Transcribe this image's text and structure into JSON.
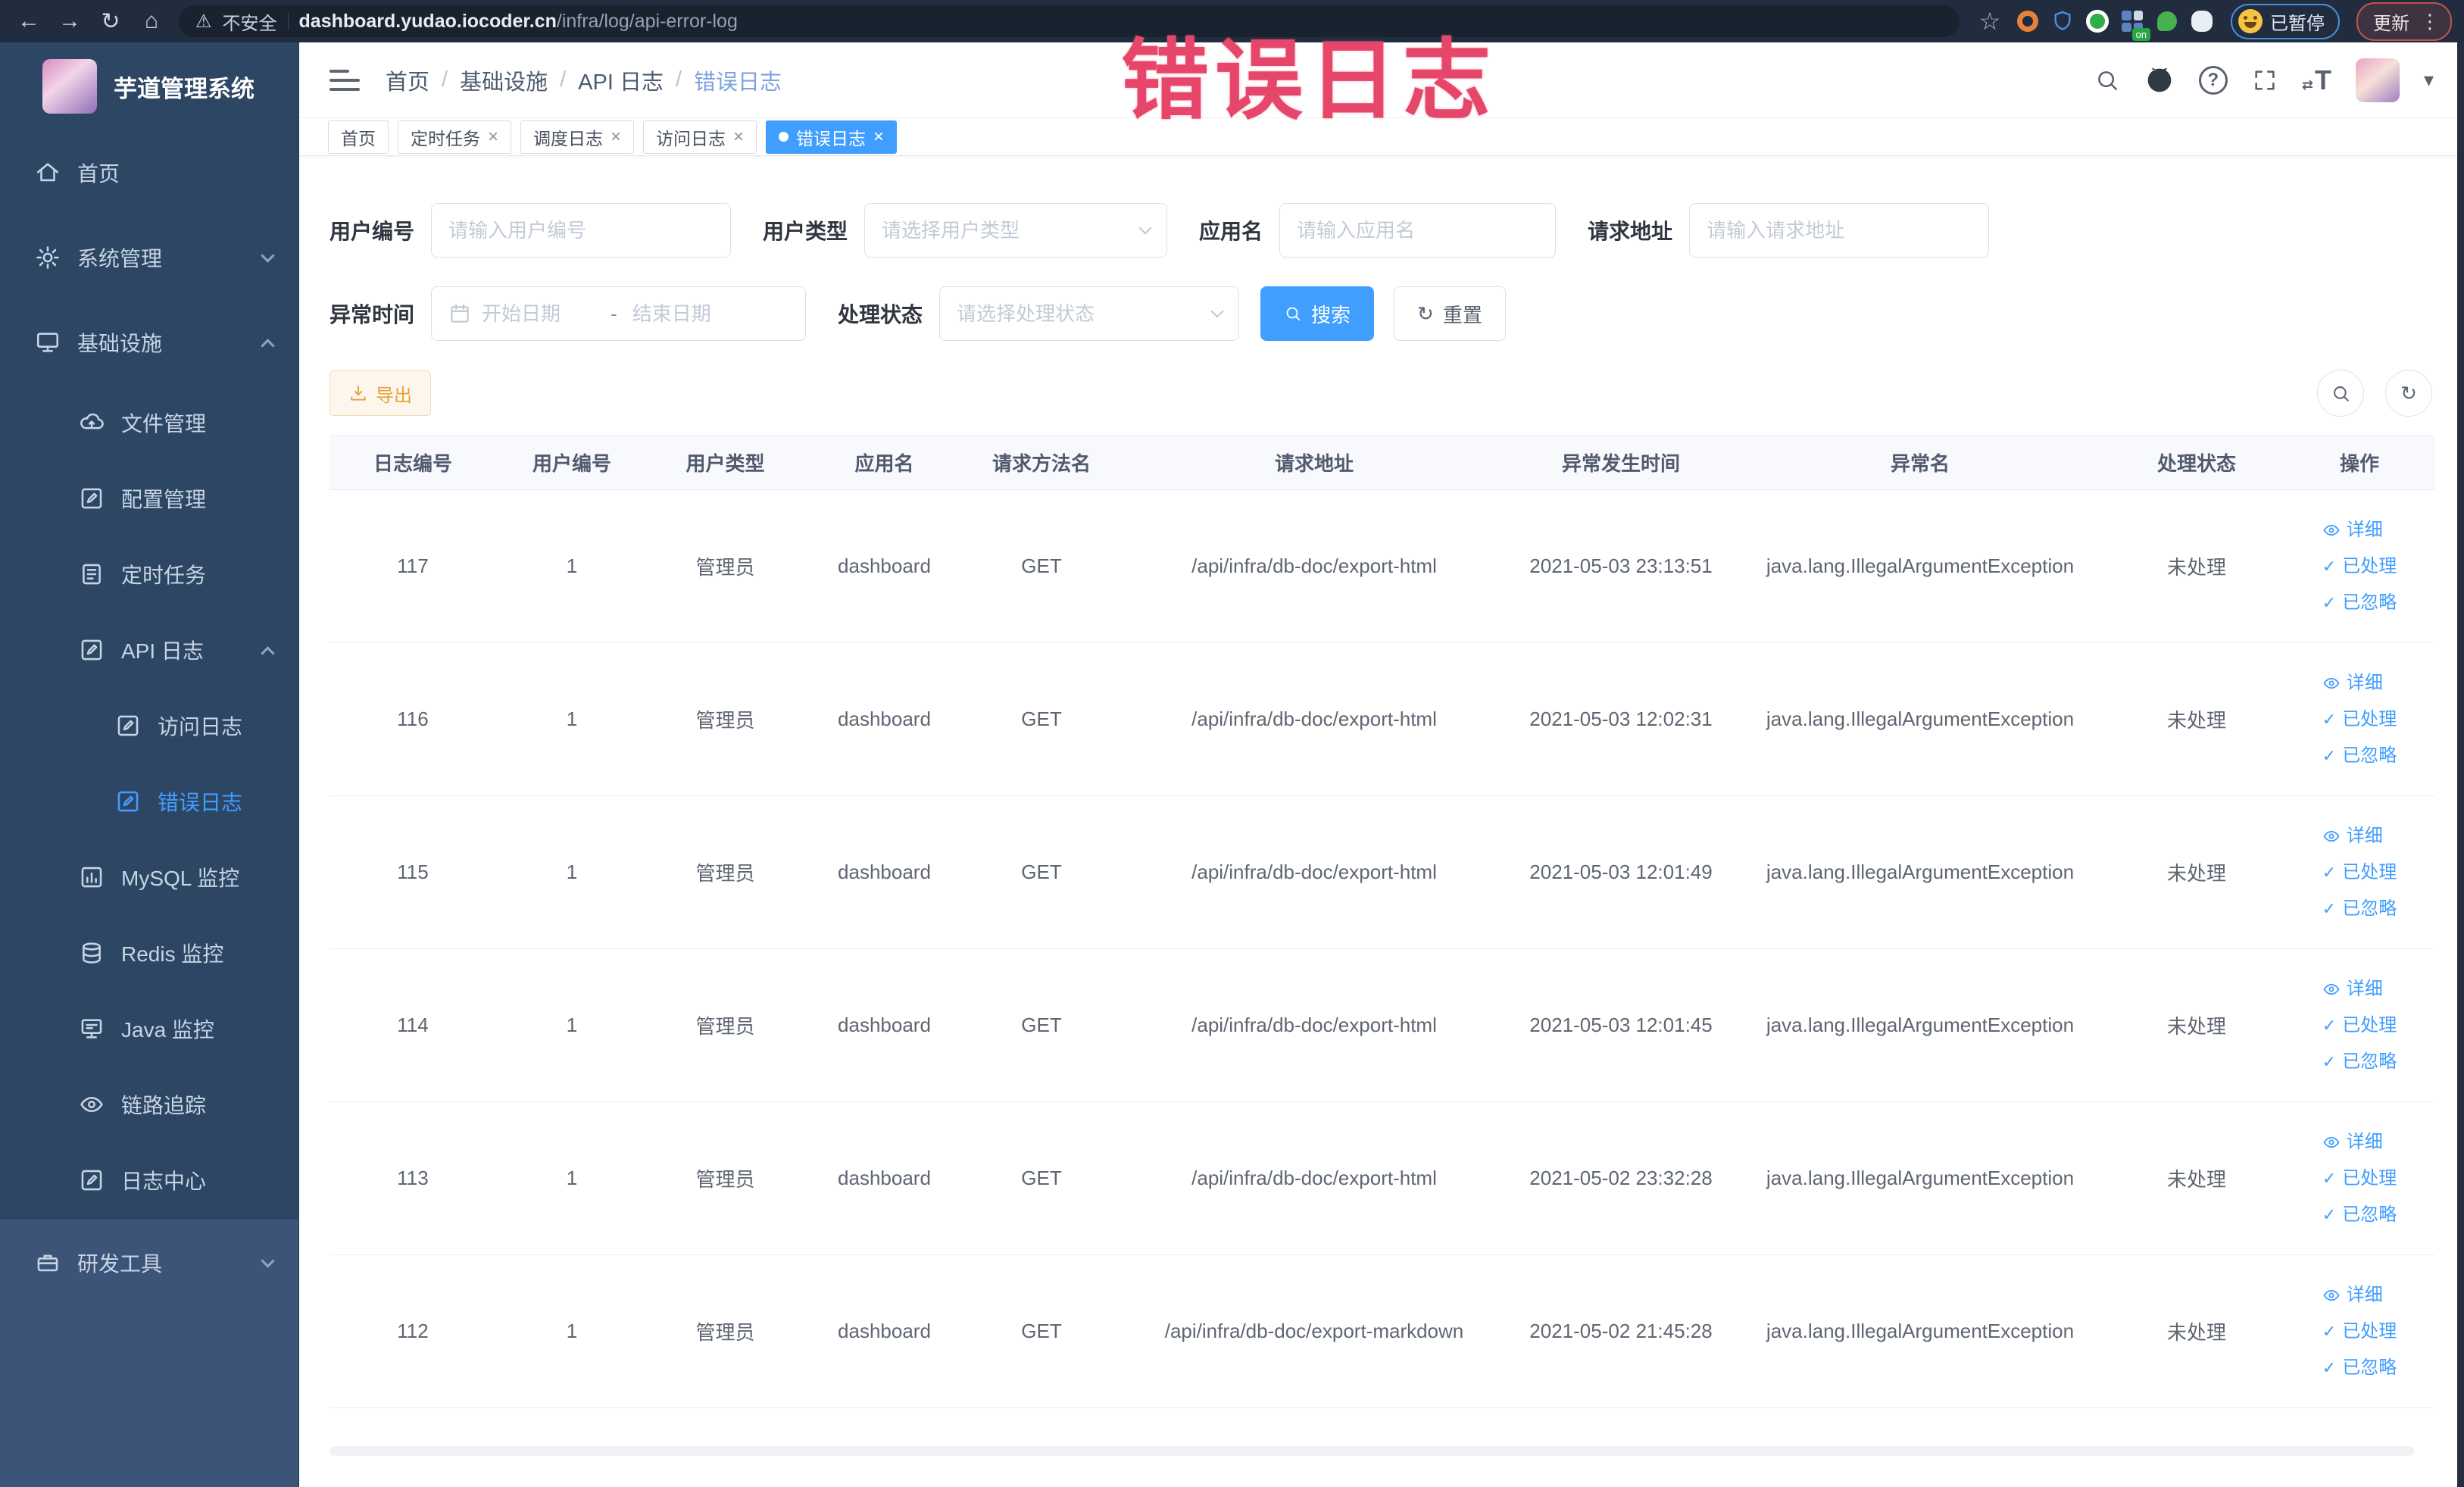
{
  "colors": {
    "primary": "#409eff",
    "warning": "#e6a23c",
    "overlay_red": "#e7466b",
    "sidebar_bg": "#2d4664",
    "chrome_bg": "#212d3f"
  },
  "overlay_text": "错误日志",
  "browser": {
    "security_label": "不安全",
    "url_host": "dashboard.yudao.iocoder.cn",
    "url_path": "/infra/log/api-error-log",
    "paused_label": "已暂停",
    "update_label": "更新"
  },
  "sidebar": {
    "title": "芋道管理系统",
    "items": [
      {
        "label": "首页"
      },
      {
        "label": "系统管理"
      },
      {
        "label": "基础设施"
      },
      {
        "label": "文件管理"
      },
      {
        "label": "配置管理"
      },
      {
        "label": "定时任务"
      },
      {
        "label": "API 日志"
      },
      {
        "label": "访问日志"
      },
      {
        "label": "错误日志"
      },
      {
        "label": "MySQL 监控"
      },
      {
        "label": "Redis 监控"
      },
      {
        "label": "Java 监控"
      },
      {
        "label": "链路追踪"
      },
      {
        "label": "日志中心"
      },
      {
        "label": "研发工具"
      }
    ]
  },
  "breadcrumb": [
    "首页",
    "基础设施",
    "API 日志",
    "错误日志"
  ],
  "tabs": [
    {
      "label": "首页"
    },
    {
      "label": "定时任务"
    },
    {
      "label": "调度日志"
    },
    {
      "label": "访问日志"
    },
    {
      "label": "错误日志"
    }
  ],
  "filters": {
    "user_id_label": "用户编号",
    "user_id_placeholder": "请输入用户编号",
    "user_type_label": "用户类型",
    "user_type_placeholder": "请选择用户类型",
    "app_name_label": "应用名",
    "app_name_placeholder": "请输入应用名",
    "request_url_label": "请求地址",
    "request_url_placeholder": "请输入请求地址",
    "exception_time_label": "异常时间",
    "start_date_placeholder": "开始日期",
    "range_separator": "-",
    "end_date_placeholder": "结束日期",
    "process_status_label": "处理状态",
    "process_status_placeholder": "请选择处理状态",
    "search_label": "搜索",
    "reset_label": "重置"
  },
  "toolbar": {
    "export_label": "导出"
  },
  "table": {
    "columns": [
      "日志编号",
      "用户编号",
      "用户类型",
      "应用名",
      "请求方法名",
      "请求地址",
      "异常发生时间",
      "异常名",
      "处理状态",
      "操作"
    ],
    "actions": [
      "详细",
      "已处理",
      "已忽略"
    ],
    "rows": [
      {
        "id": "117",
        "user_id": "1",
        "user_type": "管理员",
        "app_name": "dashboard",
        "method": "GET",
        "url": "/api/infra/db-doc/export-html",
        "time": "2021-05-03 23:13:51",
        "exception": "java.lang.IllegalArgumentException",
        "status": "未处理"
      },
      {
        "id": "116",
        "user_id": "1",
        "user_type": "管理员",
        "app_name": "dashboard",
        "method": "GET",
        "url": "/api/infra/db-doc/export-html",
        "time": "2021-05-03 12:02:31",
        "exception": "java.lang.IllegalArgumentException",
        "status": "未处理"
      },
      {
        "id": "115",
        "user_id": "1",
        "user_type": "管理员",
        "app_name": "dashboard",
        "method": "GET",
        "url": "/api/infra/db-doc/export-html",
        "time": "2021-05-03 12:01:49",
        "exception": "java.lang.IllegalArgumentException",
        "status": "未处理"
      },
      {
        "id": "114",
        "user_id": "1",
        "user_type": "管理员",
        "app_name": "dashboard",
        "method": "GET",
        "url": "/api/infra/db-doc/export-html",
        "time": "2021-05-03 12:01:45",
        "exception": "java.lang.IllegalArgumentException",
        "status": "未处理"
      },
      {
        "id": "113",
        "user_id": "1",
        "user_type": "管理员",
        "app_name": "dashboard",
        "method": "GET",
        "url": "/api/infra/db-doc/export-html",
        "time": "2021-05-02 23:32:28",
        "exception": "java.lang.IllegalArgumentException",
        "status": "未处理"
      },
      {
        "id": "112",
        "user_id": "1",
        "user_type": "管理员",
        "app_name": "dashboard",
        "method": "GET",
        "url": "/api/infra/db-doc/export-markdown",
        "time": "2021-05-02 21:45:28",
        "exception": "java.lang.IllegalArgumentException",
        "status": "未处理"
      }
    ]
  }
}
